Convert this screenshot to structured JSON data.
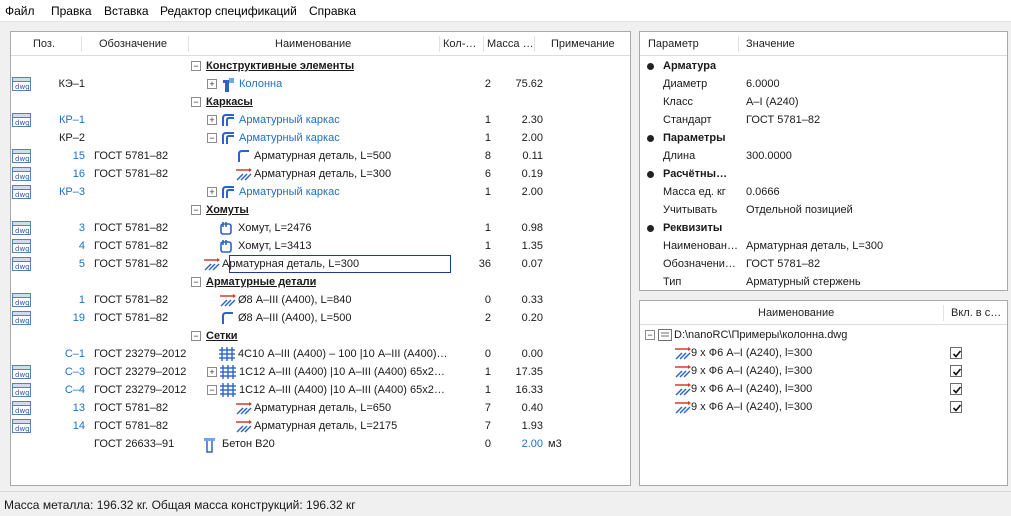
{
  "menu": [
    "Файл",
    "Правка",
    "Вставка",
    "Редактор спецификаций",
    "Справка"
  ],
  "spec_table": {
    "columns": [
      "Поз.",
      "Обозначение",
      "Наименование",
      "Кол-…",
      "Масса …",
      "Примечание"
    ],
    "rows": [
      {
        "kind": "section",
        "name": "Конструктивные элементы"
      },
      {
        "kind": "item",
        "dwg": true,
        "pos": "КЭ–1",
        "pos_blue": false,
        "designation": "",
        "expander": "+",
        "icon": "column",
        "name": "Колонна",
        "name_blue": true,
        "qty": "2",
        "mass": "75.62",
        "indent": 0
      },
      {
        "kind": "section",
        "name": "Каркасы"
      },
      {
        "kind": "item",
        "dwg": true,
        "pos": "КР–1",
        "pos_blue": true,
        "designation": "",
        "expander": "+",
        "icon": "cage",
        "name": "Арматурный каркас",
        "name_blue": true,
        "qty": "1",
        "mass": "2.30",
        "indent": 0
      },
      {
        "kind": "item",
        "dwg": false,
        "pos": "КР–2",
        "pos_blue": false,
        "designation": "",
        "expander": "−",
        "icon": "cage",
        "name": "Арматурный каркас",
        "name_blue": true,
        "qty": "1",
        "mass": "2.00",
        "indent": 0
      },
      {
        "kind": "item",
        "dwg": true,
        "pos": "15",
        "pos_blue": true,
        "designation": "ГОСТ 5781–82",
        "expander": "",
        "icon": "bent",
        "name": "Арматурная деталь, L=500",
        "name_blue": false,
        "qty": "8",
        "mass": "0.11",
        "indent": 1
      },
      {
        "kind": "item",
        "dwg": true,
        "pos": "16",
        "pos_blue": true,
        "designation": "ГОСТ 5781–82",
        "expander": "",
        "icon": "bar",
        "name": "Арматурная деталь, L=300",
        "name_blue": false,
        "qty": "6",
        "mass": "0.19",
        "indent": 1
      },
      {
        "kind": "item",
        "dwg": true,
        "pos": "КР–3",
        "pos_blue": true,
        "designation": "",
        "expander": "+",
        "icon": "cage",
        "name": "Арматурный каркас",
        "name_blue": true,
        "qty": "1",
        "mass": "2.00",
        "indent": 0
      },
      {
        "kind": "section",
        "name": "Хомуты"
      },
      {
        "kind": "item",
        "dwg": true,
        "pos": "3",
        "pos_blue": true,
        "designation": "ГОСТ 5781–82",
        "expander": "",
        "icon": "stirrup",
        "name": "Хомут, L=2476",
        "name_blue": false,
        "qty": "1",
        "mass": "0.98",
        "indent": 0
      },
      {
        "kind": "item",
        "dwg": true,
        "pos": "4",
        "pos_blue": true,
        "designation": "ГОСТ 5781–82",
        "expander": "",
        "icon": "stirrup",
        "name": "Хомут, L=3413",
        "name_blue": false,
        "qty": "1",
        "mass": "1.35",
        "indent": 0
      },
      {
        "kind": "item",
        "dwg": true,
        "pos": "5",
        "pos_blue": true,
        "designation": "ГОСТ 5781–82",
        "expander": "",
        "icon": "bar",
        "name": "Арматурная деталь, L=300",
        "name_blue": false,
        "qty": "36",
        "mass": "0.07",
        "indent": -1,
        "selected": true
      },
      {
        "kind": "section",
        "name": "Арматурные детали"
      },
      {
        "kind": "item",
        "dwg": true,
        "pos": "1",
        "pos_blue": true,
        "designation": "ГОСТ 5781–82",
        "expander": "",
        "icon": "bar",
        "name": "Ø8 А–III (А400), L=840",
        "name_blue": false,
        "qty": "0",
        "mass": "0.33",
        "indent": 0
      },
      {
        "kind": "item",
        "dwg": true,
        "pos": "19",
        "pos_blue": true,
        "designation": "ГОСТ 5781–82",
        "expander": "",
        "icon": "bent",
        "name": "Ø8 А–III (А400), L=500",
        "name_blue": false,
        "qty": "2",
        "mass": "0.20",
        "indent": 0
      },
      {
        "kind": "section",
        "name": "Сетки"
      },
      {
        "kind": "item",
        "dwg": false,
        "pos": "С–1",
        "pos_blue": true,
        "designation": "ГОСТ 23279–2012",
        "expander": "",
        "icon": "mesh",
        "name": "4С10 А–III (А400) – 100 |10 А–III (А400)…",
        "name_blue": false,
        "qty": "0",
        "mass": "0.00",
        "indent": 0
      },
      {
        "kind": "item",
        "dwg": true,
        "pos": "С–3",
        "pos_blue": true,
        "designation": "ГОСТ 23279–2012",
        "expander": "+",
        "icon": "mesh",
        "name": "1С12 А–III (А400) |10 А–III (А400) 65x2…",
        "name_blue": false,
        "qty": "1",
        "mass": "17.35",
        "indent": 0
      },
      {
        "kind": "item",
        "dwg": true,
        "pos": "С–4",
        "pos_blue": true,
        "designation": "ГОСТ 23279–2012",
        "expander": "−",
        "icon": "mesh",
        "name": "1С12 А–III (А400) |10 А–III (А400) 65x2…",
        "name_blue": false,
        "qty": "1",
        "mass": "16.33",
        "indent": 0
      },
      {
        "kind": "item",
        "dwg": true,
        "pos": "13",
        "pos_blue": true,
        "designation": "ГОСТ 5781–82",
        "expander": "",
        "icon": "bar",
        "name": "Арматурная деталь, L=650",
        "name_blue": false,
        "qty": "7",
        "mass": "0.40",
        "indent": 1
      },
      {
        "kind": "item",
        "dwg": true,
        "pos": "14",
        "pos_blue": true,
        "designation": "ГОСТ 5781–82",
        "expander": "",
        "icon": "bar",
        "name": "Арматурная деталь, L=2175",
        "name_blue": false,
        "qty": "7",
        "mass": "1.93",
        "indent": 1
      },
      {
        "kind": "item",
        "dwg": false,
        "pos": "",
        "pos_blue": false,
        "designation": "ГОСТ 26633–91",
        "expander": "",
        "icon": "concrete",
        "name": "Бетон В20",
        "name_blue": false,
        "qty": "0",
        "mass": "2.00",
        "mass_blue": true,
        "unit": "м3",
        "indent": -1
      }
    ]
  },
  "properties": {
    "columns": [
      "Параметр",
      "Значение"
    ],
    "rows": [
      {
        "kind": "group",
        "label": "Арматура"
      },
      {
        "kind": "prop",
        "label": "Диаметр",
        "value": "6.0000"
      },
      {
        "kind": "prop",
        "label": "Класс",
        "value": "А–I (А240)"
      },
      {
        "kind": "prop",
        "label": "Стандарт",
        "value": "ГОСТ 5781–82"
      },
      {
        "kind": "group",
        "label": "Параметры"
      },
      {
        "kind": "prop",
        "label": "Длина",
        "value": "300.0000"
      },
      {
        "kind": "group",
        "label": "Расчётны…"
      },
      {
        "kind": "prop",
        "label": "Масса ед. кг",
        "value": "0.0666"
      },
      {
        "kind": "prop",
        "label": "Учитывать",
        "value": "Отдельной позицией"
      },
      {
        "kind": "group",
        "label": "Реквизиты"
      },
      {
        "kind": "prop",
        "label": "Наименован…",
        "value": "Арматурная деталь, L=300"
      },
      {
        "kind": "prop",
        "label": "Обозначени…",
        "value": "ГОСТ 5781–82"
      },
      {
        "kind": "prop",
        "label": "Тип",
        "value": "Арматурный стержень"
      }
    ]
  },
  "files": {
    "columns": [
      "Наименование",
      "Вкл. в с…"
    ],
    "root": "D:\\nanoRC\\Примеры\\колонна.dwg",
    "items": [
      {
        "label": "9 x Ф6 А–I (А240), l=300",
        "checked": true
      },
      {
        "label": "9 x Ф6 А–I (А240), l=300",
        "checked": true
      },
      {
        "label": "9 x Ф6 А–I (А240), l=300",
        "checked": true
      },
      {
        "label": "9 x Ф6 А–I (А240), l=300",
        "checked": true
      }
    ]
  },
  "status": {
    "text": "Масса металла: 196.32 кг. Общая масса конструкций: 196.32 кг"
  },
  "colors": {
    "link": "#1f6fc3",
    "selection_border": "#1f3b8f",
    "icon_blue": "#2a63c9",
    "icon_red": "#d23a2a"
  }
}
